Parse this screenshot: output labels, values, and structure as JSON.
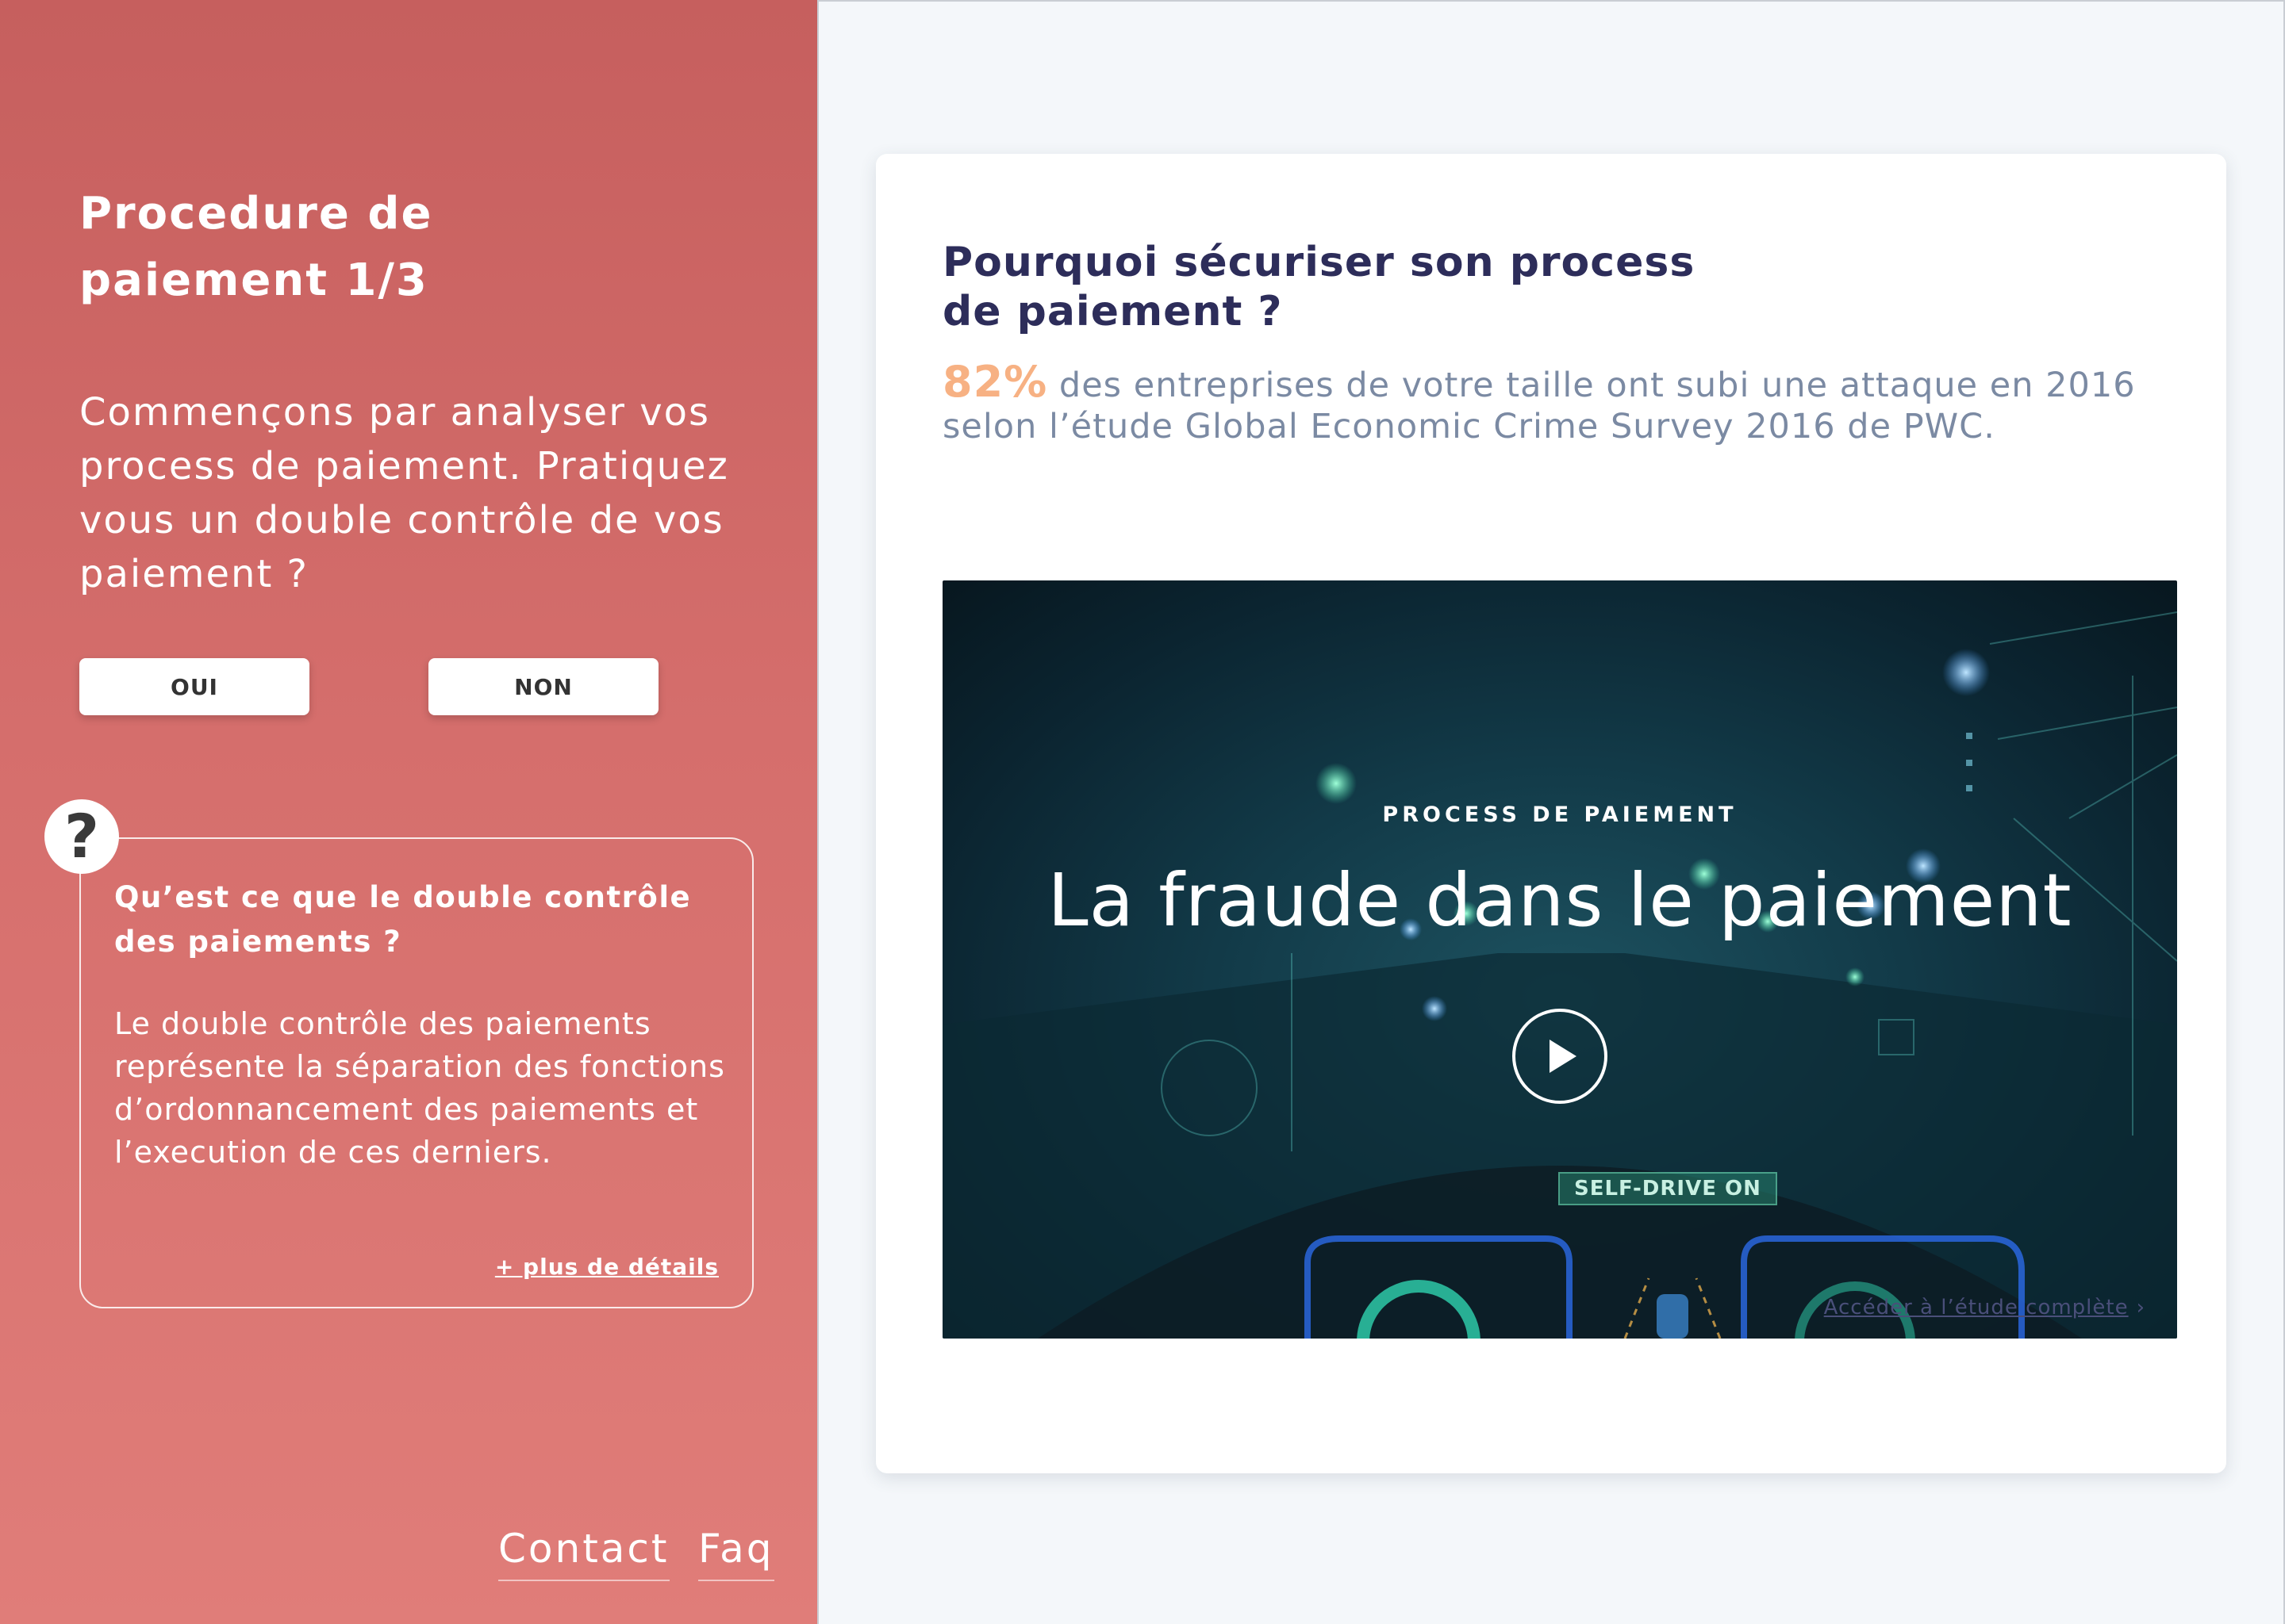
{
  "left": {
    "step_title": "Procedure de paiement 1/3",
    "question": "Commençons par analyser vos process de paiement. Pratiquez vous un double contrôle de vos paiement ?",
    "yes_label": "OUI",
    "no_label": "NON",
    "help_glyph": "?",
    "info": {
      "title": "Qu’est ce que le double contrôle des paiements ?",
      "body": "Le double contrôle des paiements représente la séparation des fonctions d’ordonnancement des paiements et l’execution de ces derniers.",
      "more_label": "+ plus de détails"
    },
    "footer": {
      "contact_label": "Contact",
      "faq_label": "Faq"
    }
  },
  "right": {
    "heading": "Pourquoi sécuriser son process de paiement ?",
    "stat_value": "82%",
    "stat_text": " des entreprises de votre taille ont subi une attaque en 2016 selon l’étude Global Economic Crime Survey 2016 de PWC.",
    "video": {
      "kicker": "PROCESS DE PAIEMENT",
      "title": "La fraude dans le paiement",
      "badge": "SELF-DRIVE ON",
      "study_link": "Accéder à l’étude complète",
      "study_chevron": "›"
    }
  },
  "colors": {
    "left_gradient_top": "#c65f5e",
    "left_gradient_bottom": "#e07d79",
    "heading": "#2d2d5a",
    "stat_accent": "#f7b183",
    "stat_text": "#7b8aa3"
  },
  "icons": {
    "help": "question-mark-icon",
    "play": "play-icon",
    "chevron": "chevron-right-icon"
  }
}
